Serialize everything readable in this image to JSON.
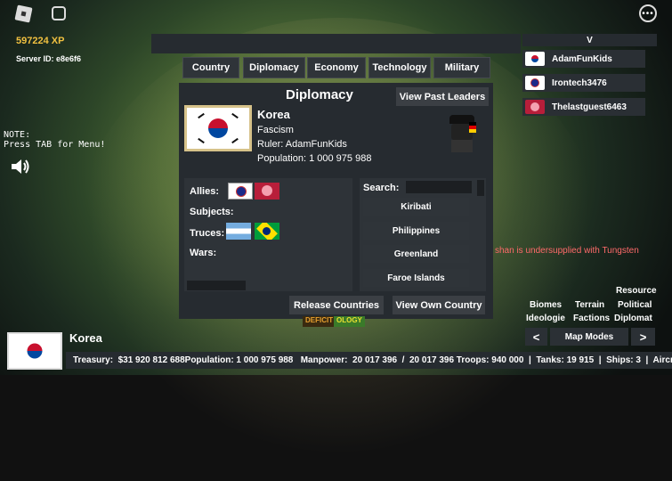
{
  "hud": {
    "xp": "597224 XP",
    "server_id": "Server ID: e8e6f6",
    "note_line1": "NOTE:",
    "note_line2": "Press TAB for Menu!"
  },
  "tabs": [
    "Country",
    "Diplomacy",
    "Economy",
    "Technology",
    "Military"
  ],
  "top_right": {
    "collapse_label": "V"
  },
  "players": [
    {
      "name": "AdamFunKids",
      "flag": "korea"
    },
    {
      "name": "Irontech3476",
      "flag": "blue-circle"
    },
    {
      "name": "Thelastguest6463",
      "flag": "red-circle"
    }
  ],
  "diplomacy": {
    "title": "Diplomacy",
    "view_past_leaders": "View Past Leaders",
    "country_name": "Korea",
    "ideology": "Fascism",
    "ruler": "Ruler: AdamFunKids",
    "population": "Population: 1 000 975 988",
    "allies_label": "Allies:",
    "subjects_label": "Subjects:",
    "truces_label": "Truces:",
    "wars_label": "Wars:",
    "search_label": "Search:",
    "search_value": "",
    "countries": [
      "Kiribati",
      "Philippines",
      "Greenland",
      "Faroe Islands"
    ],
    "release_countries": "Release Countries",
    "view_own_country": "View Own Country"
  },
  "notice": "shan is undersupplied with Tungsten",
  "map_modes": {
    "resource": "Resource",
    "biomes": "Biomes",
    "terrain": "Terrain",
    "political": "Political",
    "ideologie": "Ideologie",
    "factions": "Factions",
    "diplomat": "Diplomat",
    "prev": "<",
    "label": "Map Modes",
    "next": ">"
  },
  "bottom": {
    "country": "Korea",
    "deficit_tag": "DEFICIT",
    "ology_tag": "OLOGY",
    "stats": "Treasury:  $31 920 812 688Population: 1 000 975 988   Manpower:  20 017 396  /  20 017 396 Troops: 940 000  |  Tanks: 19 915  |  Ships: 3  |  Aircra"
  },
  "colors": {
    "panel": "#262b30",
    "button": "#2b3035",
    "notice": "#ff6a6a",
    "accent_green": "#3a7a2a"
  }
}
